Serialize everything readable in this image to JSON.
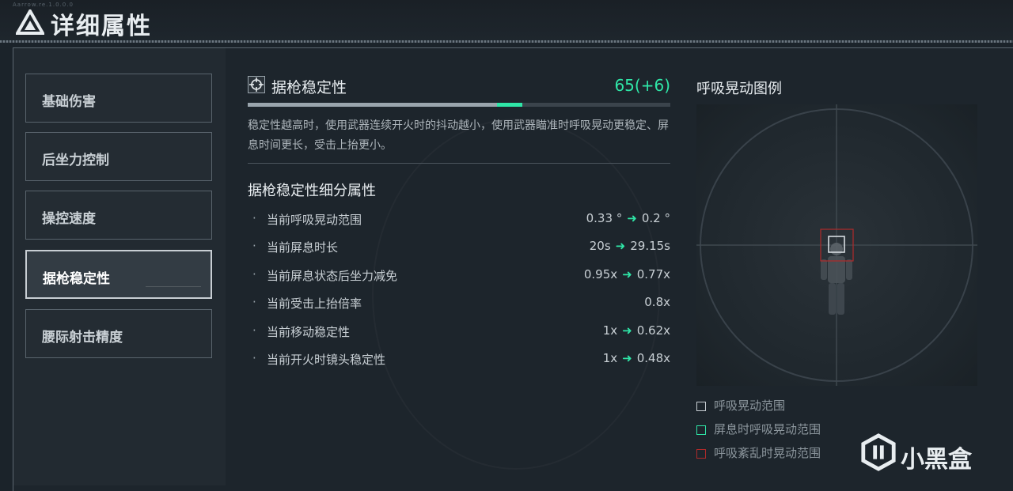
{
  "header": {
    "title": "详细属性",
    "tiny_text": "Aarrow.re.1.0.0.0"
  },
  "nav": {
    "items": [
      {
        "label": "基础伤害",
        "active": false
      },
      {
        "label": "后坐力控制",
        "active": false
      },
      {
        "label": "操控速度",
        "active": false
      },
      {
        "label": "据枪稳定性",
        "active": true
      },
      {
        "label": "腰际射击精度",
        "active": false
      }
    ]
  },
  "stat": {
    "title": "据枪稳定性",
    "value": "65(+6)",
    "base_fraction": 0.59,
    "total_fraction": 0.65,
    "description": "稳定性越高时，使用武器连续开火时的抖动越小，使用武器瞄准时呼吸晃动更稳定、屏息时间更长，受击上抬更小。"
  },
  "sub": {
    "title": "据枪稳定性细分属性",
    "rows": [
      {
        "bullet": "·",
        "name": "当前呼吸晃动范围",
        "from": "0.33 °",
        "to": "0.2 °"
      },
      {
        "bullet": "·",
        "name": "当前屏息时长",
        "from": "20s",
        "to": "29.15s"
      },
      {
        "bullet": "·",
        "name": "当前屏息状态后坐力减免",
        "from": "0.95x",
        "to": "0.77x"
      },
      {
        "bullet": "·",
        "name": "当前受击上抬倍率",
        "from": "",
        "to": "0.8x"
      },
      {
        "bullet": "·",
        "name": "当前移动稳定性",
        "from": "1x",
        "to": "0.62x"
      },
      {
        "bullet": "·",
        "name": "当前开火时镜头稳定性",
        "from": "1x",
        "to": "0.48x"
      }
    ]
  },
  "preview": {
    "title": "呼吸晃动图例",
    "legend": [
      {
        "label": "呼吸晃动范围",
        "color": "#c8ced3"
      },
      {
        "label": "屏息时呼吸晃动范围",
        "color": "#2fe6a7"
      },
      {
        "label": "呼吸紊乱时晃动范围",
        "color": "#b02a2a"
      }
    ]
  },
  "watermark": {
    "text": "小黑盒"
  },
  "arrow_glyph": "➜",
  "colors": {
    "accent": "#2fe6a7",
    "danger": "#b02a2a"
  }
}
